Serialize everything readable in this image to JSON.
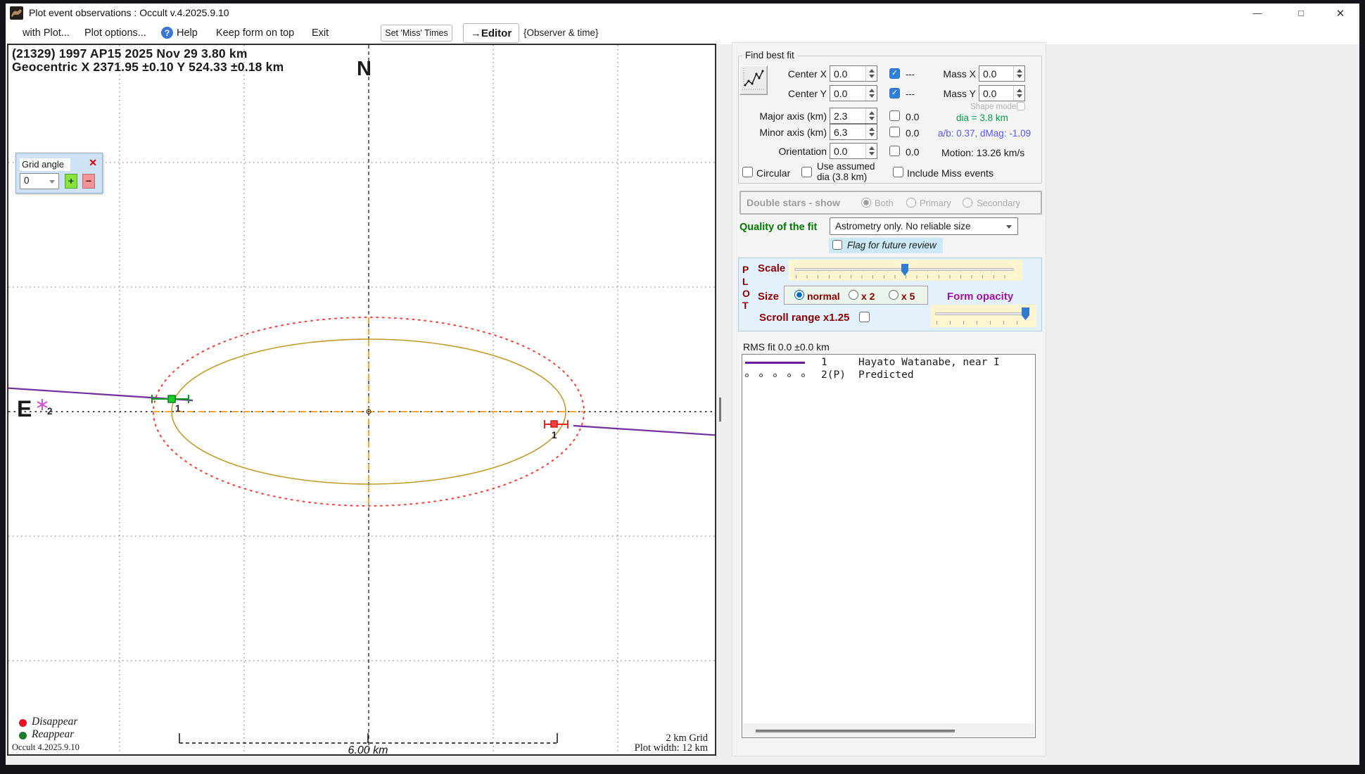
{
  "window": {
    "title": "Plot event observations : Occult v.4.2025.9.10"
  },
  "icons": {
    "help": "?",
    "minimize": "—",
    "maximize": "□",
    "close": "✕",
    "grid_angle_close": "✕",
    "plus": "+",
    "minus": "−",
    "check": "✓"
  },
  "menu": {
    "with_plot": "with Plot...",
    "plot_options": "Plot options...",
    "help": "Help",
    "keep_on_top": "Keep form on top",
    "exit": "Exit",
    "set_miss_times": "Set 'Miss' Times",
    "editor": "→Editor",
    "observer_time": "{Observer & time}"
  },
  "plot": {
    "header_line1": "(21329) 1997 AP15  2025 Nov 29   3.80 km",
    "header_line2": "Geocentric  X  2371.95 ±0.10  Y 524.33 ±0.18 km",
    "north": "N",
    "east": "E",
    "grid_angle": {
      "title": "Grid angle",
      "value": "0"
    },
    "markers": {
      "chord1_left": "1",
      "chord1_right": "1",
      "predicted": "2"
    },
    "scale_bar": "6.00 km",
    "grid_text": "2 km Grid",
    "width_text": "Plot width: 12 km",
    "legend": {
      "disappear": "Disappear",
      "reappear": "Reappear"
    },
    "version": "Occult 4.2025.9.10"
  },
  "find_best_fit": {
    "title": "Find best fit",
    "center_x": {
      "label": "Center X",
      "value": "0.0",
      "locked": "---"
    },
    "center_y": {
      "label": "Center Y",
      "value": "0.0",
      "locked": "---"
    },
    "mass_x": {
      "label": "Mass X",
      "value": "0.0"
    },
    "mass_y": {
      "label": "Mass Y",
      "value": "0.0"
    },
    "shape_model": "Shape model",
    "major_axis": {
      "label": "Major axis (km)",
      "value": "2.3",
      "fit": "0.0"
    },
    "minor_axis": {
      "label": "Minor axis (km)",
      "value": "6.3",
      "fit": "0.0"
    },
    "orientation": {
      "label": "Orientation",
      "value": "0.0",
      "fit": "0.0"
    },
    "dia": "dia = 3.8 km",
    "ab": "a/b: 0.37, dMag: -1.09",
    "motion": "Motion: 13.26 km/s",
    "circular": "Circular",
    "use_assumed_1": "Use assumed",
    "use_assumed_2": "dia (3.8 km)",
    "include_miss": "Include Miss events"
  },
  "double_stars": {
    "title": "Double stars - show",
    "both": "Both",
    "primary": "Primary",
    "secondary": "Secondary"
  },
  "quality": {
    "label": "Quality of the fit",
    "value": "Astrometry only. No reliable size",
    "flag": "Flag for future review"
  },
  "plot_controls": {
    "p": "P",
    "l": "L",
    "o": "O",
    "t": "T",
    "scale": "Scale",
    "size": "Size",
    "normal": "normal",
    "x2": "x 2",
    "x5": "x 5",
    "form_opacity": "Form opacity",
    "scroll_range": "Scroll range x1.25"
  },
  "rms": "RMS fit  0.0 ±0.0 km",
  "observers": [
    {
      "num": "1",
      "name": "Hayato Watanabe, near I"
    },
    {
      "num": "2(P)",
      "name": "Predicted"
    }
  ]
}
